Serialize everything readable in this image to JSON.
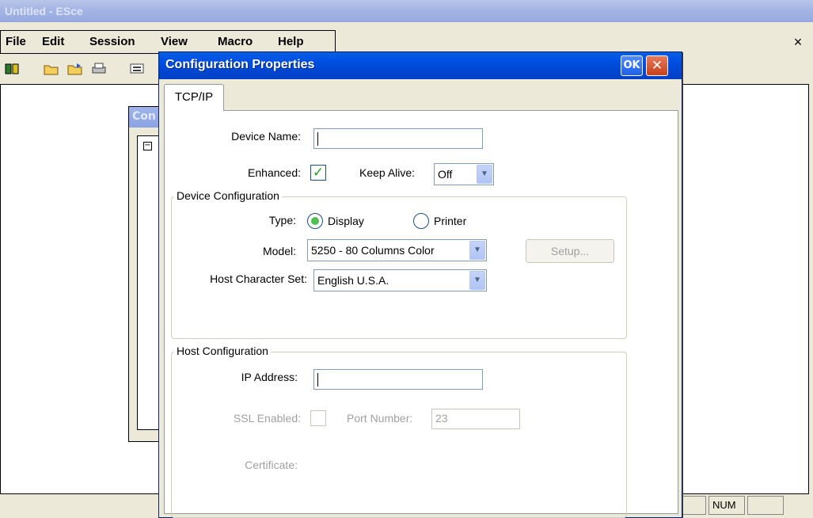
{
  "app": {
    "title": "Untitled - ESce",
    "menu": [
      "File",
      "Edit",
      "Session",
      "View",
      "Macro",
      "Help"
    ],
    "close_glyph": "×",
    "toolbar_icons": [
      "connect-icon",
      "open-folder-icon",
      "open-folder-icon",
      "print-icon",
      "session-icon"
    ],
    "status": {
      "num": "NUM"
    },
    "background_child_title": "Con"
  },
  "dialog": {
    "title": "Configuration Properties",
    "ok_label": "OK",
    "close_glyph": "✕",
    "tab": "TCP/IP",
    "device_name": {
      "label": "Device Name:",
      "value": ""
    },
    "enhanced": {
      "label": "Enhanced:",
      "checked": true
    },
    "keep_alive": {
      "label": "Keep Alive:",
      "value": "Off"
    },
    "device_configuration": {
      "title": "Device Configuration",
      "type_label": "Type:",
      "type_options": [
        "Display",
        "Printer"
      ],
      "type_selected": "Display",
      "model_label": "Model:",
      "model_value": "5250 - 80 Columns Color",
      "setup_label": "Setup...",
      "charset_label": "Host Character Set:",
      "charset_value": "English U.S.A."
    },
    "host_configuration": {
      "title": "Host Configuration",
      "ip_label": "IP Address:",
      "ip_value": "",
      "ssl_label": "SSL Enabled:",
      "port_label": "Port Number:",
      "port_value": "23",
      "certificate_label": "Certificate:"
    }
  },
  "colors": {
    "dialog_titlebar": "#0048d6",
    "window_face": "#ECE9D8",
    "check_green": "#21a121"
  }
}
